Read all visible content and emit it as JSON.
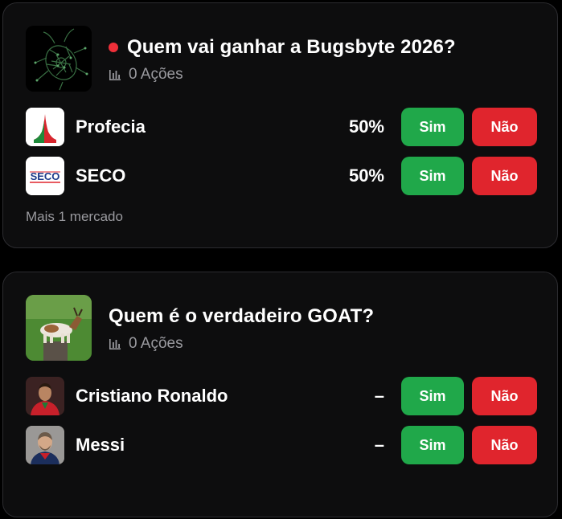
{
  "markets": [
    {
      "title": "Quem vai ganhar a Bugsbyte 2026?",
      "live": true,
      "volume": "0 Ações",
      "outcomes": [
        {
          "label": "Profecia",
          "percent": "50%",
          "yes": "Sim",
          "no": "Não"
        },
        {
          "label": "SECO",
          "percent": "50%",
          "yes": "Sim",
          "no": "Não",
          "logo_text": "SECO"
        }
      ],
      "more": "Mais 1 mercado"
    },
    {
      "title": "Quem é o verdadeiro GOAT?",
      "live": false,
      "volume": "0 Ações",
      "outcomes": [
        {
          "label": "Cristiano Ronaldo",
          "percent": "–",
          "yes": "Sim",
          "no": "Não"
        },
        {
          "label": "Messi",
          "percent": "–",
          "yes": "Sim",
          "no": "Não"
        }
      ]
    }
  ],
  "colors": {
    "yes": "#20a84a",
    "no": "#e0252d",
    "live": "#ef2f39",
    "muted": "#9a9a9f",
    "card_bg": "#0d0d0e"
  }
}
